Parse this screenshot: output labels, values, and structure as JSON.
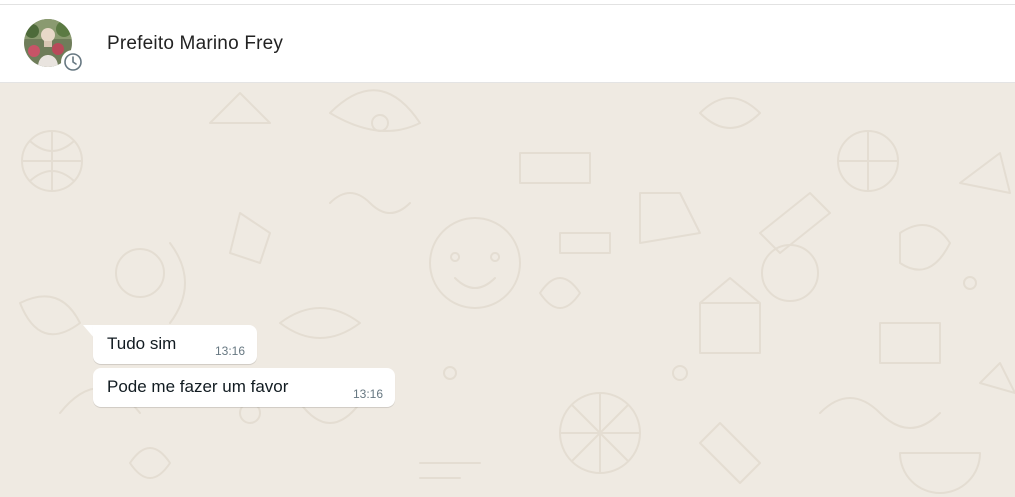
{
  "header": {
    "contact_name": "Prefeito Marino Frey",
    "avatar_icon": "contact-avatar",
    "status_icon": "status-clock-icon"
  },
  "messages": [
    {
      "text": "Tudo sim",
      "time": "13:16"
    },
    {
      "text": "Pode me fazer um favor",
      "time": "13:16"
    }
  ],
  "colors": {
    "chat_background": "#efeae2",
    "bubble_incoming": "#ffffff",
    "time_text": "#667781"
  }
}
